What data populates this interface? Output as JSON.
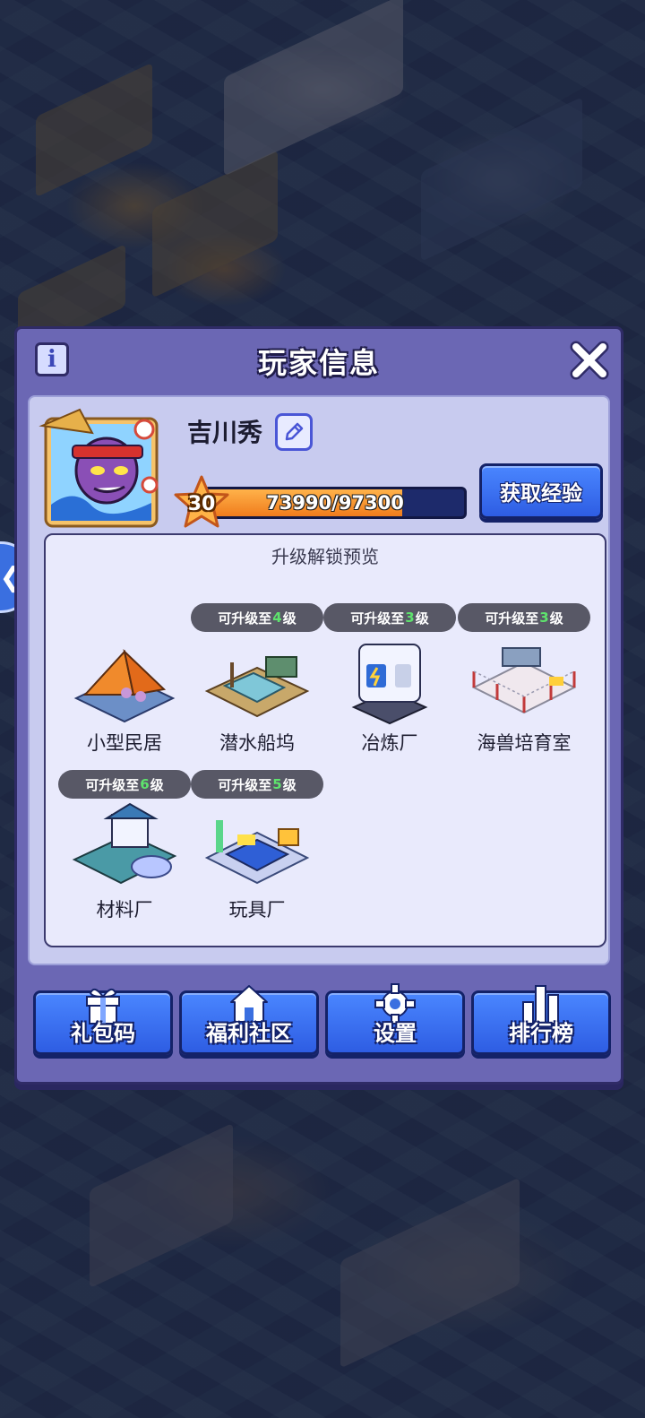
{
  "dialog": {
    "title": "玩家信息"
  },
  "player": {
    "name": "吉川秀",
    "level": "30",
    "exp_text": "73990/97300",
    "exp_progress": 0.76,
    "get_exp_label": "获取经验"
  },
  "preview": {
    "title": "升级解锁预览",
    "buildings": [
      {
        "name": "小型民居",
        "badge_prefix": "",
        "badge_level": "",
        "badge_suffix": ""
      },
      {
        "name": "潜水船坞",
        "badge_prefix": "可升级至",
        "badge_level": "4",
        "badge_suffix": "级"
      },
      {
        "name": "冶炼厂",
        "badge_prefix": "可升级至",
        "badge_level": "3",
        "badge_suffix": "级"
      },
      {
        "name": "海兽培育室",
        "badge_prefix": "可升级至",
        "badge_level": "3",
        "badge_suffix": "级"
      },
      {
        "name": "材料厂",
        "badge_prefix": "可升级至",
        "badge_level": "6",
        "badge_suffix": "级"
      },
      {
        "name": "玩具厂",
        "badge_prefix": "可升级至",
        "badge_level": "5",
        "badge_suffix": "级"
      }
    ]
  },
  "bottom_buttons": {
    "gift_code": "礼包码",
    "community": "福利社区",
    "settings": "设置",
    "ranking": "排行榜"
  },
  "icons": {
    "info": "info-icon",
    "close": "close-icon",
    "edit": "pencil-icon",
    "star": "star-icon",
    "gift": "gift-icon",
    "home": "home-icon",
    "gear": "gear-icon",
    "chart": "bar-chart-icon",
    "side": "collapse-arrow-icon"
  },
  "colors": {
    "dialog_frame": "#6b67b4",
    "panel": "#c8cbef",
    "button_blue": "#2e5de3",
    "exp_orange": "#f07c1c",
    "badge_level_green": "#5ee36d"
  }
}
